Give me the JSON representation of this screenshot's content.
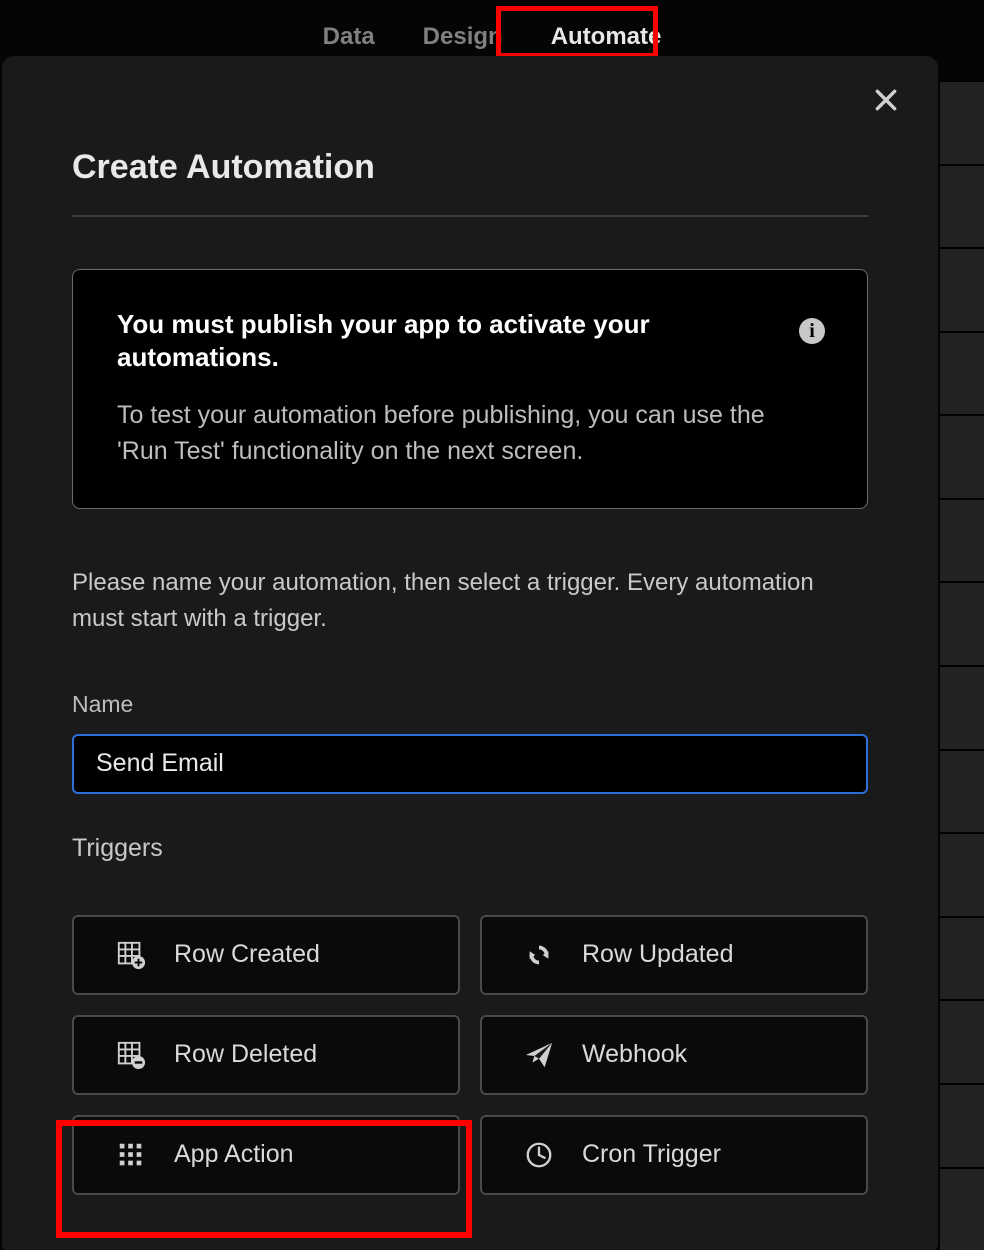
{
  "nav": {
    "tabs": [
      "Data",
      "Design",
      "Automate"
    ],
    "active": "Automate"
  },
  "modal": {
    "title": "Create Automation",
    "info": {
      "title": "You must publish your app to activate your automations.",
      "body": "To test your automation before publishing, you can use the 'Run Test' functionality on the next screen."
    },
    "instructions": "Please name your automation, then select a trigger. Every automation must start with a trigger.",
    "name_label": "Name",
    "name_value": "Send Email",
    "triggers_label": "Triggers",
    "triggers": [
      {
        "label": "Row Created",
        "icon": "table-add"
      },
      {
        "label": "Row Updated",
        "icon": "refresh"
      },
      {
        "label": "Row Deleted",
        "icon": "table-remove"
      },
      {
        "label": "Webhook",
        "icon": "paper-plane"
      },
      {
        "label": "App Action",
        "icon": "grid-dots"
      },
      {
        "label": "Cron Trigger",
        "icon": "clock"
      }
    ]
  }
}
